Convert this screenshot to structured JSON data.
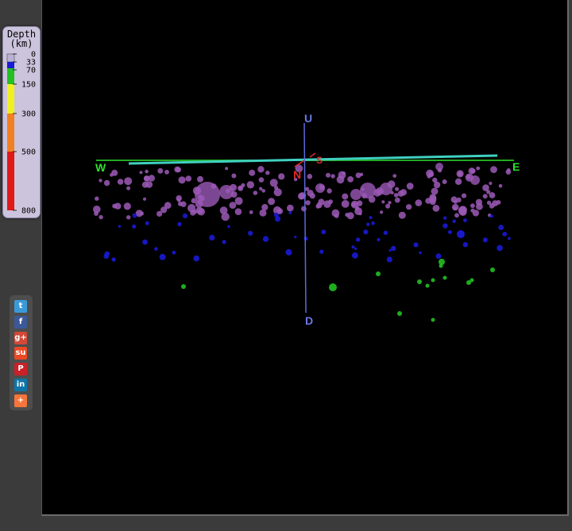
{
  "legend": {
    "title_line1": "Depth",
    "title_line2": "(km)",
    "ticks": [
      "0",
      "33",
      "70",
      "150",
      "300",
      "500",
      "800"
    ]
  },
  "axes": {
    "west": "W",
    "east": "E",
    "north": "N",
    "south": "S",
    "up": "U",
    "down": "D"
  },
  "colors": {
    "shallow": "#9b59b6",
    "intermediate": "#1a1ad6",
    "deep": "#22c022",
    "axis_ew": "#22aa22",
    "axis_ns": "#40d0c0",
    "axis_ud": "#5a6adc",
    "label_ew": "#2ee02e",
    "label_ns": "#e02a2a",
    "label_ud": "#6a7ae8"
  },
  "share_buttons": [
    {
      "icon": "twitter-icon",
      "glyph": "t",
      "color": "#3a9ad9"
    },
    {
      "icon": "facebook-icon",
      "glyph": "f",
      "color": "#3b5998"
    },
    {
      "icon": "google-plus-icon",
      "glyph": "g+",
      "color": "#d34836"
    },
    {
      "icon": "stumbleupon-icon",
      "glyph": "su",
      "color": "#eb4924"
    },
    {
      "icon": "pinterest-icon",
      "glyph": "P",
      "color": "#cb2027"
    },
    {
      "icon": "linkedin-icon",
      "glyph": "in",
      "color": "#0e76a8"
    },
    {
      "icon": "add-more-icon",
      "glyph": "+",
      "color": "#f7753a"
    }
  ]
}
